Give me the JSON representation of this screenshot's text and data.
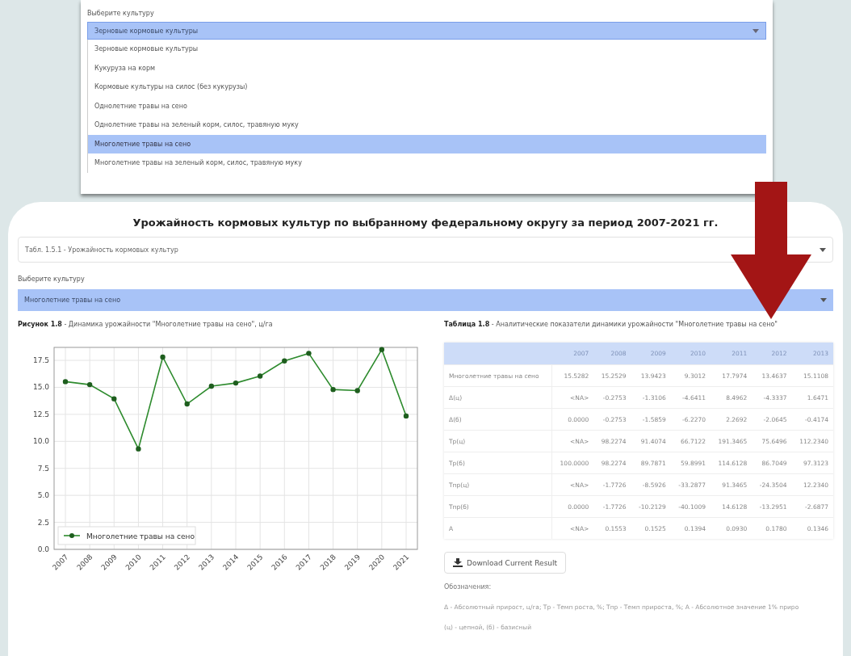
{
  "top_panel": {
    "label": "Выберите культуру",
    "select": {
      "value": "Зерновые кормовые культуры"
    },
    "options": [
      {
        "label": "Зерновые кормовые культуры",
        "selected": false
      },
      {
        "label": "Кукуруза на корм",
        "selected": false
      },
      {
        "label": "Кормовые культуры на силос (без кукурузы)",
        "selected": false
      },
      {
        "label": "Однолетние травы на сено",
        "selected": false
      },
      {
        "label": "Однолетние травы на зеленый корм, силос, травяную муку",
        "selected": false
      },
      {
        "label": "Многолетние травы на сено",
        "selected": true
      },
      {
        "label": "Многолетние травы на зеленый корм, силос, травяную муку",
        "selected": false
      }
    ]
  },
  "title": "Урожайность кормовых культур по выбранному федеральному округу за период 2007-2021 гг.",
  "report_select": {
    "value": "Табл. 1.5.1 - Урожайность кормовых культур"
  },
  "crop_label": "Выберите культуру",
  "crop_select": {
    "value": "Многолетние травы на сено"
  },
  "figure": {
    "caption": "**Рисунок 1.8** - Динамика урожайности \"Многолетние травы на сено\", ц/га",
    "chart_data": {
      "type": "line",
      "categories": [
        "2007",
        "2008",
        "2009",
        "2010",
        "2011",
        "2012",
        "2013",
        "2014",
        "2015",
        "2016",
        "2017",
        "2018",
        "2019",
        "2020",
        "2021"
      ],
      "grid": true,
      "series": [
        {
          "name": "Многолетние травы на сено",
          "color": "#2e8b2e",
          "marker": "o",
          "values": [
            15.53,
            15.25,
            13.94,
            9.3,
            17.8,
            13.46,
            15.11,
            15.4,
            16.05,
            17.45,
            18.15,
            14.8,
            14.7,
            18.5,
            12.35
          ]
        }
      ],
      "ylim": [
        0,
        18.7
      ],
      "yticks": [
        {
          "value": 0,
          "label": "0.0"
        },
        {
          "value": 2.5,
          "label": "2.5"
        },
        {
          "value": 5,
          "label": "5.0"
        },
        {
          "value": 7.5,
          "label": "7.5"
        },
        {
          "value": 10,
          "label": "10.0"
        },
        {
          "value": 12.5,
          "label": "12.5"
        },
        {
          "value": 15,
          "label": "15.0"
        },
        {
          "value": 17.5,
          "label": "17.5"
        }
      ]
    }
  },
  "table": {
    "caption": "**Таблица 1.8** - Аналитические показатели динамики урожайности \"Многолетние травы на сено\"",
    "columns": [
      "2007",
      "2008",
      "2009",
      "2010",
      "2011",
      "2012",
      "2013"
    ],
    "rows": [
      {
        "label": "Многолетние травы на сено",
        "values": [
          "15.5282",
          "15.2529",
          "13.9423",
          "9.3012",
          "17.7974",
          "13.4637",
          "15.1108"
        ]
      },
      {
        "label": "Δ(ц)",
        "values": [
          "<NA>",
          "-0.2753",
          "-1.3106",
          "-4.6411",
          "8.4962",
          "-4.3337",
          "1.6471"
        ]
      },
      {
        "label": "Δ(б)",
        "values": [
          "0.0000",
          "-0.2753",
          "-1.5859",
          "-6.2270",
          "2.2692",
          "-2.0645",
          "-0.4174"
        ]
      },
      {
        "label": "Тр(ц)",
        "values": [
          "<NA>",
          "98.2274",
          "91.4074",
          "66.7122",
          "191.3465",
          "75.6496",
          "112.2340"
        ]
      },
      {
        "label": "Тр(б)",
        "values": [
          "100.0000",
          "98.2274",
          "89.7871",
          "59.8991",
          "114.6128",
          "86.7049",
          "97.3123"
        ]
      },
      {
        "label": "Тпр(ц)",
        "values": [
          "<NA>",
          "-1.7726",
          "-8.5926",
          "-33.2877",
          "91.3465",
          "-24.3504",
          "12.2340"
        ]
      },
      {
        "label": "Тпр(б)",
        "values": [
          "0.0000",
          "-1.7726",
          "-10.2129",
          "-40.1009",
          "14.6128",
          "-13.2951",
          "-2.6877"
        ]
      },
      {
        "label": "А",
        "values": [
          "<NA>",
          "0.1553",
          "0.1525",
          "0.1394",
          "0.0930",
          "0.1780",
          "0.1346"
        ]
      }
    ]
  },
  "download_button": {
    "label": "Download Current Result"
  },
  "notes": {
    "heading": "Обозначения:",
    "lines": [
      "Δ - Абсолютный прирост, ц/га; Тр - Темп роста, %; Тпр - Темп прироста, %; А - Абсолютное значение 1% приро",
      "(ц) - цепной, (б) - базисный"
    ]
  }
}
